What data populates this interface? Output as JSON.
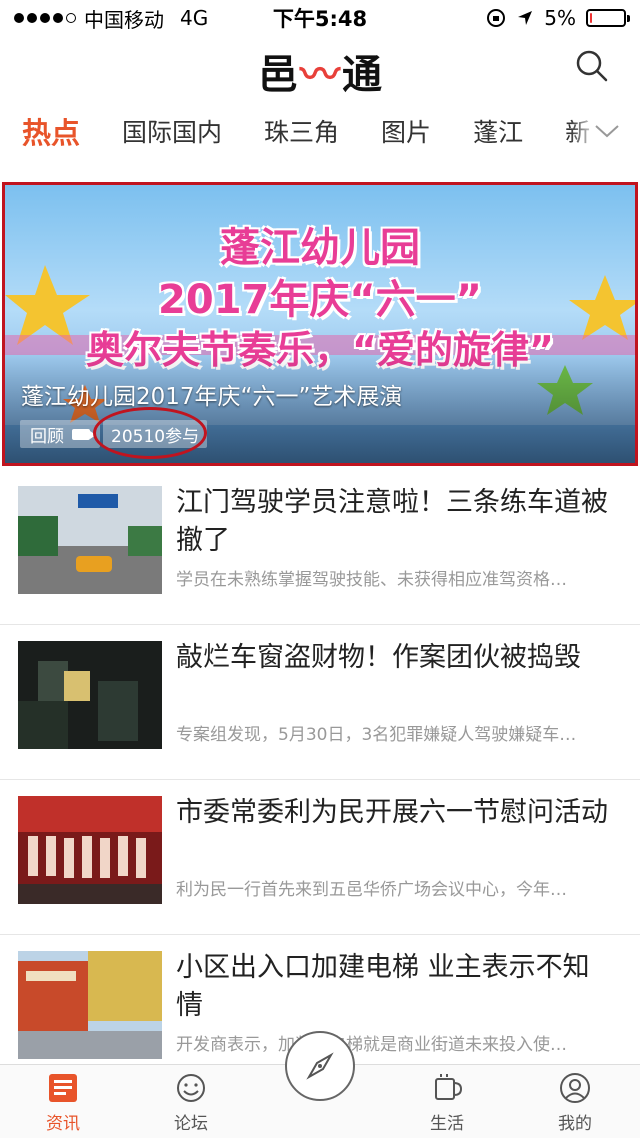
{
  "status_bar": {
    "carrier": "中国移动",
    "network": "4G",
    "time": "下午5:48",
    "battery_percent": "5%",
    "battery_level": 0.05,
    "battery_color": "#ee3333"
  },
  "header": {
    "logo_text_left": "邑",
    "logo_text_right": "通",
    "search_icon": "search-icon"
  },
  "tabs": [
    "热点",
    "国际国内",
    "珠三角",
    "图片",
    "蓬江",
    "新"
  ],
  "active_tab": "热点",
  "banner": {
    "art_line1": "蓬江幼儿园",
    "art_line2": "2017年庆“六一”",
    "art_line3": "奥尔夫节奏乐，“爱的旋律”",
    "caption": "蓬江幼儿园2017年庆“六一”艺术展演",
    "replay_label": "回顾",
    "participants": "20510参与"
  },
  "news": [
    {
      "title": "江门驾驶学员注意啦！三条练车道被撤了",
      "summary": "学员在未熟练掌握驾驶技能、未获得相应准驾资格…"
    },
    {
      "title": " 敲烂车窗盗财物！作案团伙被捣毁",
      "summary": "专案组发现，5月30日，3名犯罪嫌疑人驾驶嫌疑车…"
    },
    {
      "title": "市委常委利为民开展六一节慰问活动",
      "summary": "利为民一行首先来到五邑华侨广场会议中心，今年…"
    },
    {
      "title": "小区出入口加建电梯 业主表示不知情",
      "summary": "开发商表示，加装的电梯就是商业街道未来投入使…"
    }
  ],
  "bottom_nav": [
    {
      "label": "资讯",
      "icon": "news-icon",
      "active": true
    },
    {
      "label": "论坛",
      "icon": "smiley-icon",
      "active": false
    },
    {
      "label": "",
      "icon": "compass-icon",
      "active": false
    },
    {
      "label": "生活",
      "icon": "cup-icon",
      "active": false
    },
    {
      "label": "我的",
      "icon": "user-icon",
      "active": false
    }
  ],
  "colors": {
    "accent": "#e8542a",
    "highlight_border": "#c0141f",
    "brand_red": "#e8403a"
  }
}
